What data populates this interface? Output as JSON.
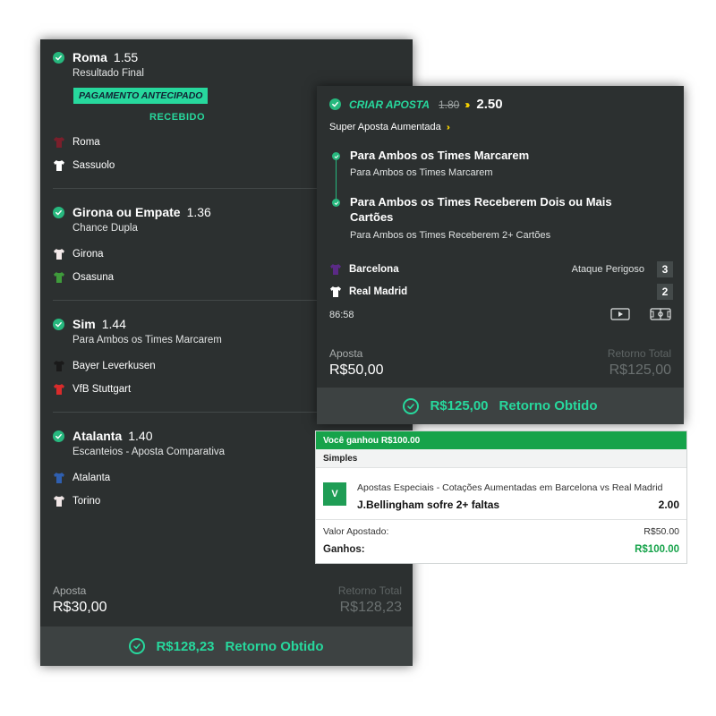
{
  "left": {
    "selections": [
      {
        "name": "Roma",
        "odd": "1.55",
        "market": "Resultado Final",
        "teams": [
          "Roma",
          "Sassuolo"
        ]
      },
      {
        "name": "Girona ou Empate",
        "odd": "1.36",
        "market": "Chance Dupla",
        "teams": [
          "Girona",
          "Osasuna"
        ]
      },
      {
        "name": "Sim",
        "odd": "1.44",
        "market": "Para Ambos os Times Marcarem",
        "teams": [
          "Bayer Leverkusen",
          "VfB Stuttgart"
        ]
      },
      {
        "name": "Atalanta",
        "odd": "1.40",
        "market": "Escanteios - Aposta Comparativa",
        "teams": [
          "Atalanta",
          "Torino"
        ]
      }
    ],
    "badge": "PAGAMENTO ANTECIPADO",
    "received": "RECEBIDO",
    "stake_label": "Aposta",
    "stake": "R$30,00",
    "return_label": "Retorno Total",
    "return": "R$128,23",
    "footer_amount": "R$128,23",
    "footer_label": "Retorno Obtido"
  },
  "right": {
    "criar": "CRIAR APOSTA",
    "old_odd": "1.80",
    "new_odd": "2.50",
    "super": "Super Aposta Aumentada",
    "legs": [
      {
        "title": "Para Ambos os Times Marcarem",
        "sub": "Para Ambos os Times Marcarem"
      },
      {
        "title": "Para Ambos os Times Receberem Dois ou Mais Cartões",
        "sub": "Para Ambos os Times Receberem 2+ Cartões"
      }
    ],
    "home": "Barcelona",
    "away": "Real Madrid",
    "attack": "Ataque Perigoso",
    "home_score": "3",
    "away_score": "2",
    "clock": "86:58",
    "stake_label": "Aposta",
    "stake": "R$50,00",
    "return_label": "Retorno Total",
    "return": "R$125,00",
    "footer_amount": "R$125,00",
    "footer_label": "Retorno Obtido"
  },
  "card": {
    "won": "Você ganhou R$100.00",
    "type": "Simples",
    "v": "V",
    "category": "Apostas Especiais - Cotações Aumentadas em Barcelona vs Real Madrid",
    "bet": "J.Bellingham sofre 2+ faltas",
    "odd": "2.00",
    "stake_label": "Valor Apostado:",
    "stake": "R$50.00",
    "winnings_label": "Ganhos:",
    "winnings": "R$100.00"
  },
  "colors": {
    "accent": "#27d89d",
    "panel": "#2c3030",
    "win_green": "#16a34a",
    "boost": "#f5d000"
  }
}
